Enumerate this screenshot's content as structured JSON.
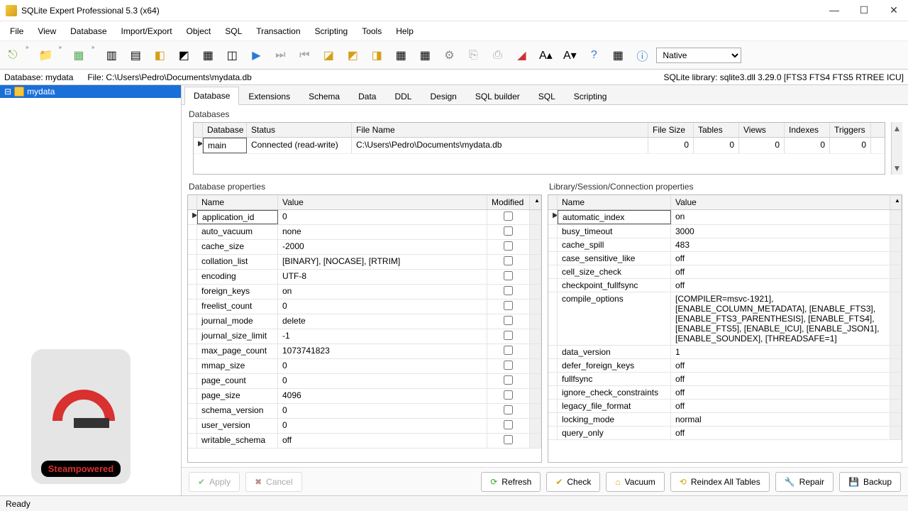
{
  "window": {
    "title": "SQLite Expert Professional 5.3 (x64)"
  },
  "menu": [
    "File",
    "View",
    "Database",
    "Import/Export",
    "Object",
    "SQL",
    "Transaction",
    "Scripting",
    "Tools",
    "Help"
  ],
  "toolbar_mode": "Native",
  "infobar": {
    "db_label": "Database: mydata",
    "file_label": "File: C:\\Users\\Pedro\\Documents\\mydata.db",
    "lib_label": "SQLite library: sqlite3.dll 3.29.0 [FTS3 FTS4 FTS5 RTREE ICU]"
  },
  "tree": {
    "selected": "mydata"
  },
  "watermark": "Steampowered",
  "tabs": [
    "Database",
    "Extensions",
    "Schema",
    "Data",
    "DDL",
    "Design",
    "SQL builder",
    "SQL",
    "Scripting"
  ],
  "active_tab": 0,
  "sections": {
    "databases": "Databases",
    "db_props": "Database properties",
    "lib_props": "Library/Session/Connection properties"
  },
  "db_grid": {
    "cols": [
      "Database",
      "Status",
      "File Name",
      "File Size",
      "Tables",
      "Views",
      "Indexes",
      "Triggers"
    ],
    "row": {
      "database": "main",
      "status": "Connected (read-write)",
      "file": "C:\\Users\\Pedro\\Documents\\mydata.db",
      "filesize": "0",
      "tables": "0",
      "views": "0",
      "indexes": "0",
      "triggers": "0"
    }
  },
  "db_props": {
    "cols": [
      "Name",
      "Value",
      "Modified"
    ],
    "rows": [
      {
        "n": "application_id",
        "v": "0"
      },
      {
        "n": "auto_vacuum",
        "v": "none"
      },
      {
        "n": "cache_size",
        "v": "-2000"
      },
      {
        "n": "collation_list",
        "v": "[BINARY], [NOCASE], [RTRIM]"
      },
      {
        "n": "encoding",
        "v": "UTF-8"
      },
      {
        "n": "foreign_keys",
        "v": "on"
      },
      {
        "n": "freelist_count",
        "v": "0"
      },
      {
        "n": "journal_mode",
        "v": "delete"
      },
      {
        "n": "journal_size_limit",
        "v": "-1"
      },
      {
        "n": "max_page_count",
        "v": "1073741823"
      },
      {
        "n": "mmap_size",
        "v": "0"
      },
      {
        "n": "page_count",
        "v": "0"
      },
      {
        "n": "page_size",
        "v": "4096"
      },
      {
        "n": "schema_version",
        "v": "0"
      },
      {
        "n": "user_version",
        "v": "0"
      },
      {
        "n": "writable_schema",
        "v": "off"
      }
    ]
  },
  "lib_props": {
    "cols": [
      "Name",
      "Value"
    ],
    "rows": [
      {
        "n": "automatic_index",
        "v": "on"
      },
      {
        "n": "busy_timeout",
        "v": "3000"
      },
      {
        "n": "cache_spill",
        "v": "483"
      },
      {
        "n": "case_sensitive_like",
        "v": "off"
      },
      {
        "n": "cell_size_check",
        "v": "off"
      },
      {
        "n": "checkpoint_fullfsync",
        "v": "off"
      },
      {
        "n": "compile_options",
        "v": "[COMPILER=msvc-1921], [ENABLE_COLUMN_METADATA], [ENABLE_FTS3], [ENABLE_FTS3_PARENTHESIS], [ENABLE_FTS4], [ENABLE_FTS5], [ENABLE_ICU], [ENABLE_JSON1], [ENABLE_SOUNDEX], [THREADSAFE=1]"
      },
      {
        "n": "data_version",
        "v": "1"
      },
      {
        "n": "defer_foreign_keys",
        "v": "off"
      },
      {
        "n": "fullfsync",
        "v": "off"
      },
      {
        "n": "ignore_check_constraints",
        "v": "off"
      },
      {
        "n": "legacy_file_format",
        "v": "off"
      },
      {
        "n": "locking_mode",
        "v": "normal"
      },
      {
        "n": "query_only",
        "v": "off"
      }
    ]
  },
  "buttons": {
    "apply": "Apply",
    "cancel": "Cancel",
    "refresh": "Refresh",
    "check": "Check",
    "vacuum": "Vacuum",
    "reindex": "Reindex All Tables",
    "repair": "Repair",
    "backup": "Backup"
  },
  "status": "Ready"
}
